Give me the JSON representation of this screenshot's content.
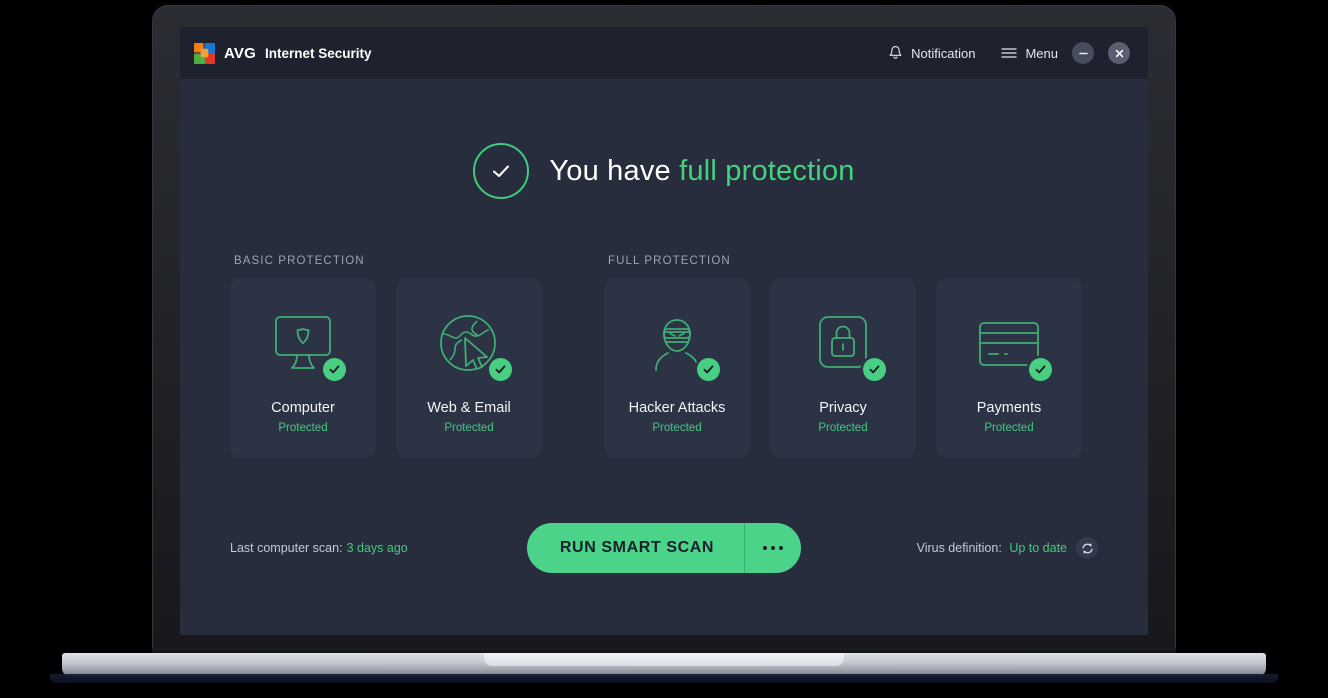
{
  "window": {
    "brand_name": "AVG",
    "product_name": "Internet Security",
    "notification_label": "Notification",
    "menu_label": "Menu",
    "minimize_label": "Minimize",
    "close_label": "Close",
    "colors": {
      "accent_green": "#44d17f",
      "titlebar_bg": "#1d222e",
      "app_bg": "#272d3d",
      "card_bg": "#2c3345",
      "button_green": "#4bd489"
    }
  },
  "status": {
    "headline_prefix": "You have",
    "headline_accent": "full protection",
    "icon": "check-circle-icon"
  },
  "sections": [
    {
      "id": "basic",
      "title": "BASIC PROTECTION"
    },
    {
      "id": "full",
      "title": "FULL PROTECTION"
    }
  ],
  "cards": {
    "basic": [
      {
        "title": "Computer",
        "status": "Protected",
        "icon": "monitor-shield-icon"
      },
      {
        "title": "Web & Email",
        "status": "Protected",
        "icon": "globe-cursor-icon"
      }
    ],
    "full": [
      {
        "title": "Hacker Attacks",
        "status": "Protected",
        "icon": "masked-hacker-icon"
      },
      {
        "title": "Privacy",
        "status": "Protected",
        "icon": "lock-document-icon"
      },
      {
        "title": "Payments",
        "status": "Protected",
        "icon": "credit-card-icon"
      }
    ]
  },
  "footer": {
    "last_scan_label": "Last computer scan:",
    "last_scan_value": "3 days ago",
    "scan_button_label": "RUN SMART SCAN",
    "scan_more_label": "More scan options",
    "virus_def_label": "Virus definition:",
    "virus_def_value": "Up to date",
    "refresh_label": "Refresh virus definitions"
  }
}
